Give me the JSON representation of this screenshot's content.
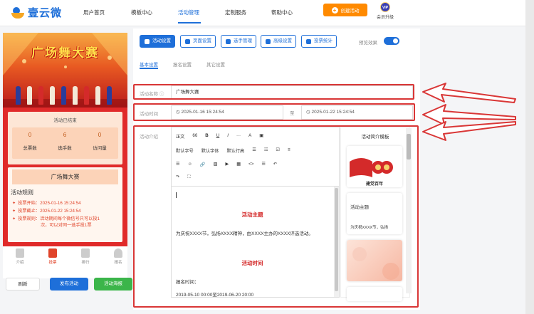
{
  "topnav": {
    "brand": "壹云微",
    "items": [
      "用户首页",
      "模板中心",
      "活动管理",
      "定制服务",
      "帮助中心"
    ],
    "create_label": "创建活动",
    "vip_badge": "VIP",
    "vip_label": "会员升级"
  },
  "preview": {
    "banner_title": "广场舞大赛",
    "status": "活动已结束",
    "stats": [
      {
        "value": "0",
        "label": "总票数"
      },
      {
        "value": "6",
        "label": "选手数"
      },
      {
        "value": "0",
        "label": "访问量"
      }
    ],
    "event_name": "广场舞大赛",
    "rules_title": "活动规则",
    "rules": [
      "投票开始：2025-01-16 15:24:54",
      "投票截止：2025-01-22 15:24:54",
      "投票规则：活动期间每个微信号只可以投1",
      "次，可以对同一选手投1票"
    ],
    "bottom_tabs": [
      "介绍",
      "投票",
      "排行",
      "报名"
    ]
  },
  "left_buttons": {
    "refresh": "刷新",
    "publish": "发布活动",
    "poster": "活动海报"
  },
  "toolbar": {
    "buttons": [
      "活动设置",
      "页面设置",
      "选手管理",
      "高级设置",
      "投票统计"
    ],
    "preview_label": "预览效果"
  },
  "subtabs": [
    "基本设置",
    "报名设置",
    "其它设置"
  ],
  "form": {
    "name_label": "活动名称",
    "name_value": "广场舞大赛",
    "time_label": "活动时间",
    "start_time": "2025-01-16 15:24:54",
    "separator": "至",
    "end_time": "2025-01-22 15:24:54",
    "intro_label": "活动介绍"
  },
  "editor": {
    "row1": [
      "正文",
      "66",
      "B",
      "U",
      "I",
      "···",
      "A",
      "▣"
    ],
    "row2": [
      "默认字号",
      "默认字体",
      "默认行高",
      "☰",
      "☷",
      "☑",
      "≡"
    ],
    "row3": [
      "☰",
      "☺",
      "🔗",
      "▨",
      "▶",
      "▦",
      "<>",
      "☰",
      "↶"
    ],
    "row4": [
      "↷",
      "⛶"
    ],
    "heading1": "活动主题",
    "para1": "为庆祝XXXX节，弘扬XXXX精神，由XXXX主办的XXXX评选活动。",
    "heading2": "活动时间",
    "para2": "报名时间：",
    "para3": "2019-05-10 00:00至2019-06-20 20:00"
  },
  "templates": {
    "title": "活动简介模板",
    "card1_text": "建党百年",
    "card2_title": "活动主题",
    "card2_text": "为庆祝XXXX节，弘扬"
  },
  "colors": {
    "primary": "#1e6fd9",
    "accent": "#ff8a00",
    "highlight": "#d93636"
  }
}
